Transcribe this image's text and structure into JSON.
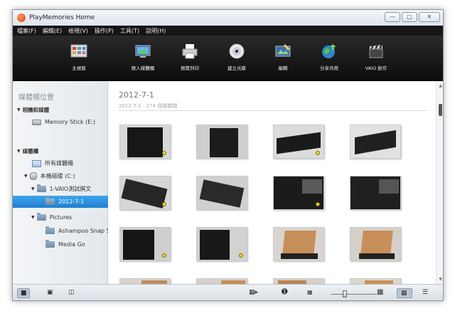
{
  "window": {
    "title": "PlayMemories Home"
  },
  "menu": [
    "檔案(F)",
    "編輯(E)",
    "檢視(V)",
    "操作(P)",
    "工具(T)",
    "說明(H)"
  ],
  "toolbar": {
    "items": [
      {
        "label": "主視窗",
        "icon": "main-window-icon"
      },
      {
        "label": "匯入媒體櫃",
        "icon": "import-icon"
      },
      {
        "label": "預覽列印",
        "icon": "printer-icon"
      },
      {
        "label": "建立光碟",
        "icon": "disc-icon"
      },
      {
        "label": "編輯",
        "icon": "edit-icon"
      },
      {
        "label": "分享共用",
        "icon": "globe-share-icon"
      },
      {
        "label": "VAIO 創作",
        "icon": "clapperboard-icon"
      }
    ]
  },
  "sidebar": {
    "title": "媒體櫃位置",
    "devices_header": "相機和媒體",
    "device_item": "Memory Stick (E:)",
    "library_header": "媒體櫃",
    "all_media": "所有媒體櫃",
    "local_disk": "本機磁碟 (C:)",
    "folder_vaio": "1-VAIO測試撰文",
    "folder_date": "2012-7-1",
    "folder_pictures": "Pictures",
    "folder_ashampoo": "Ashampoo Snap 5",
    "folder_mediago": "Media Go"
  },
  "content": {
    "title": "2012-7-1",
    "subtitle": "2012-7-1 - 274 個媒體檔"
  },
  "colors": {
    "selection": "#2b8fdf",
    "toolbar_bg": "#151515",
    "marker": "#f6d31a"
  }
}
